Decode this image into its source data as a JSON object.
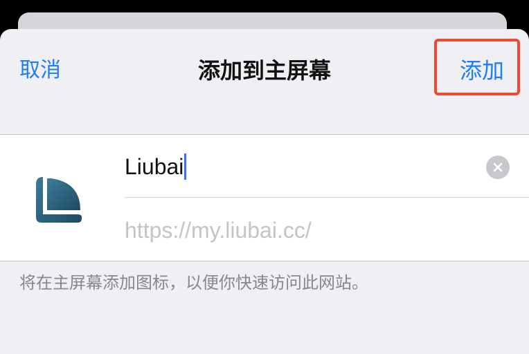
{
  "header": {
    "cancel_label": "取消",
    "title": "添加到主屏幕",
    "add_label": "添加"
  },
  "bookmark": {
    "icon": "liubai-app-icon",
    "name": "Liubai",
    "url": "https://my.liubai.cc/"
  },
  "hint_text": "将在主屏幕添加图标，以便你快速访问此网站。",
  "colors": {
    "accent": "#1a7ef7",
    "highlight": "#ef4a2f",
    "icon_dark": "#1f4a63",
    "icon_light": "#3d7c98"
  }
}
